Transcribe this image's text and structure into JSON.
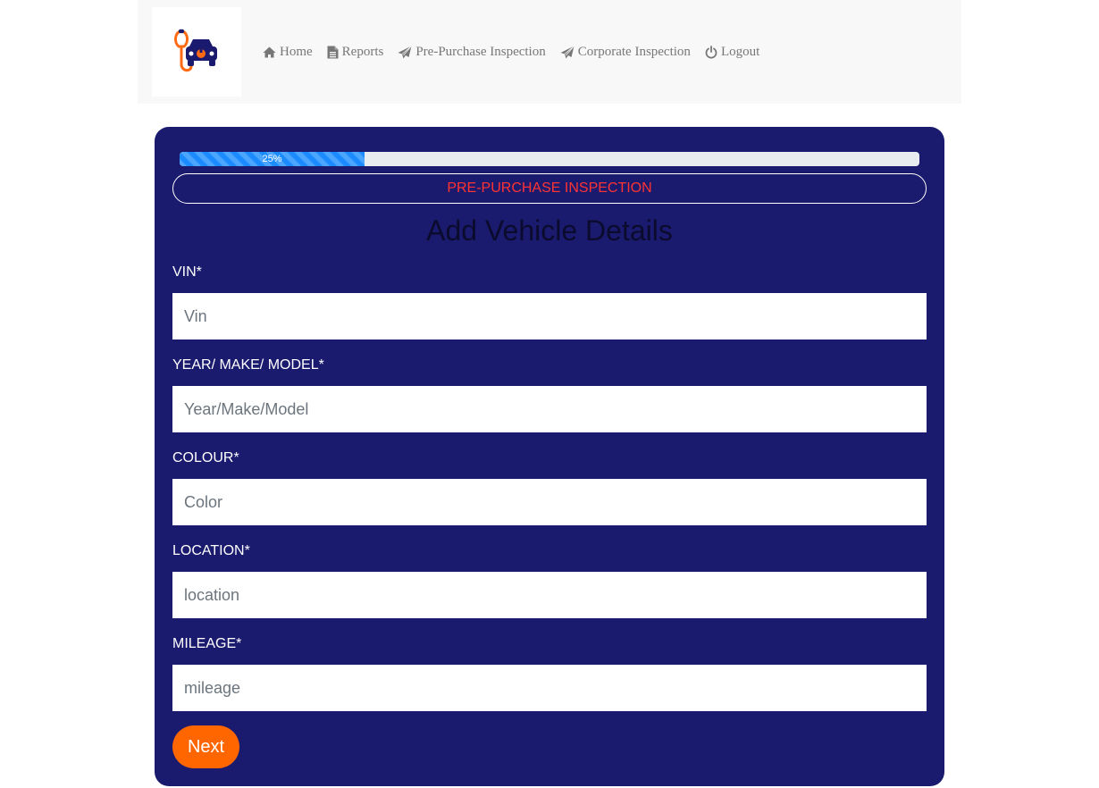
{
  "nav": {
    "items": [
      {
        "label": "Home",
        "icon": "home-icon"
      },
      {
        "label": "Reports",
        "icon": "file-icon"
      },
      {
        "label": "Pre-Purchase Inspection",
        "icon": "paper-plane-icon"
      },
      {
        "label": "Corporate Inspection",
        "icon": "paper-plane-icon"
      },
      {
        "label": "Logout",
        "icon": "power-icon"
      }
    ]
  },
  "progress": {
    "label": "25%",
    "value": 0.25
  },
  "inspection_type": "PRE-PURCHASE INSPECTION",
  "form": {
    "title": "Add Vehicle Details",
    "fields": [
      {
        "label": "VIN*",
        "placeholder": "Vin"
      },
      {
        "label": "YEAR/ MAKE/ MODEL*",
        "placeholder": "Year/Make/Model"
      },
      {
        "label": "COLOUR*",
        "placeholder": "Color"
      },
      {
        "label": "LOCATION*",
        "placeholder": "location"
      },
      {
        "label": "MILEAGE*",
        "placeholder": "mileage"
      }
    ],
    "next_label": "Next"
  },
  "colors": {
    "panel": "#1a1a6e",
    "accent": "#ff6600",
    "progress": "#1a8cff",
    "inspection_text": "#ff3333"
  }
}
